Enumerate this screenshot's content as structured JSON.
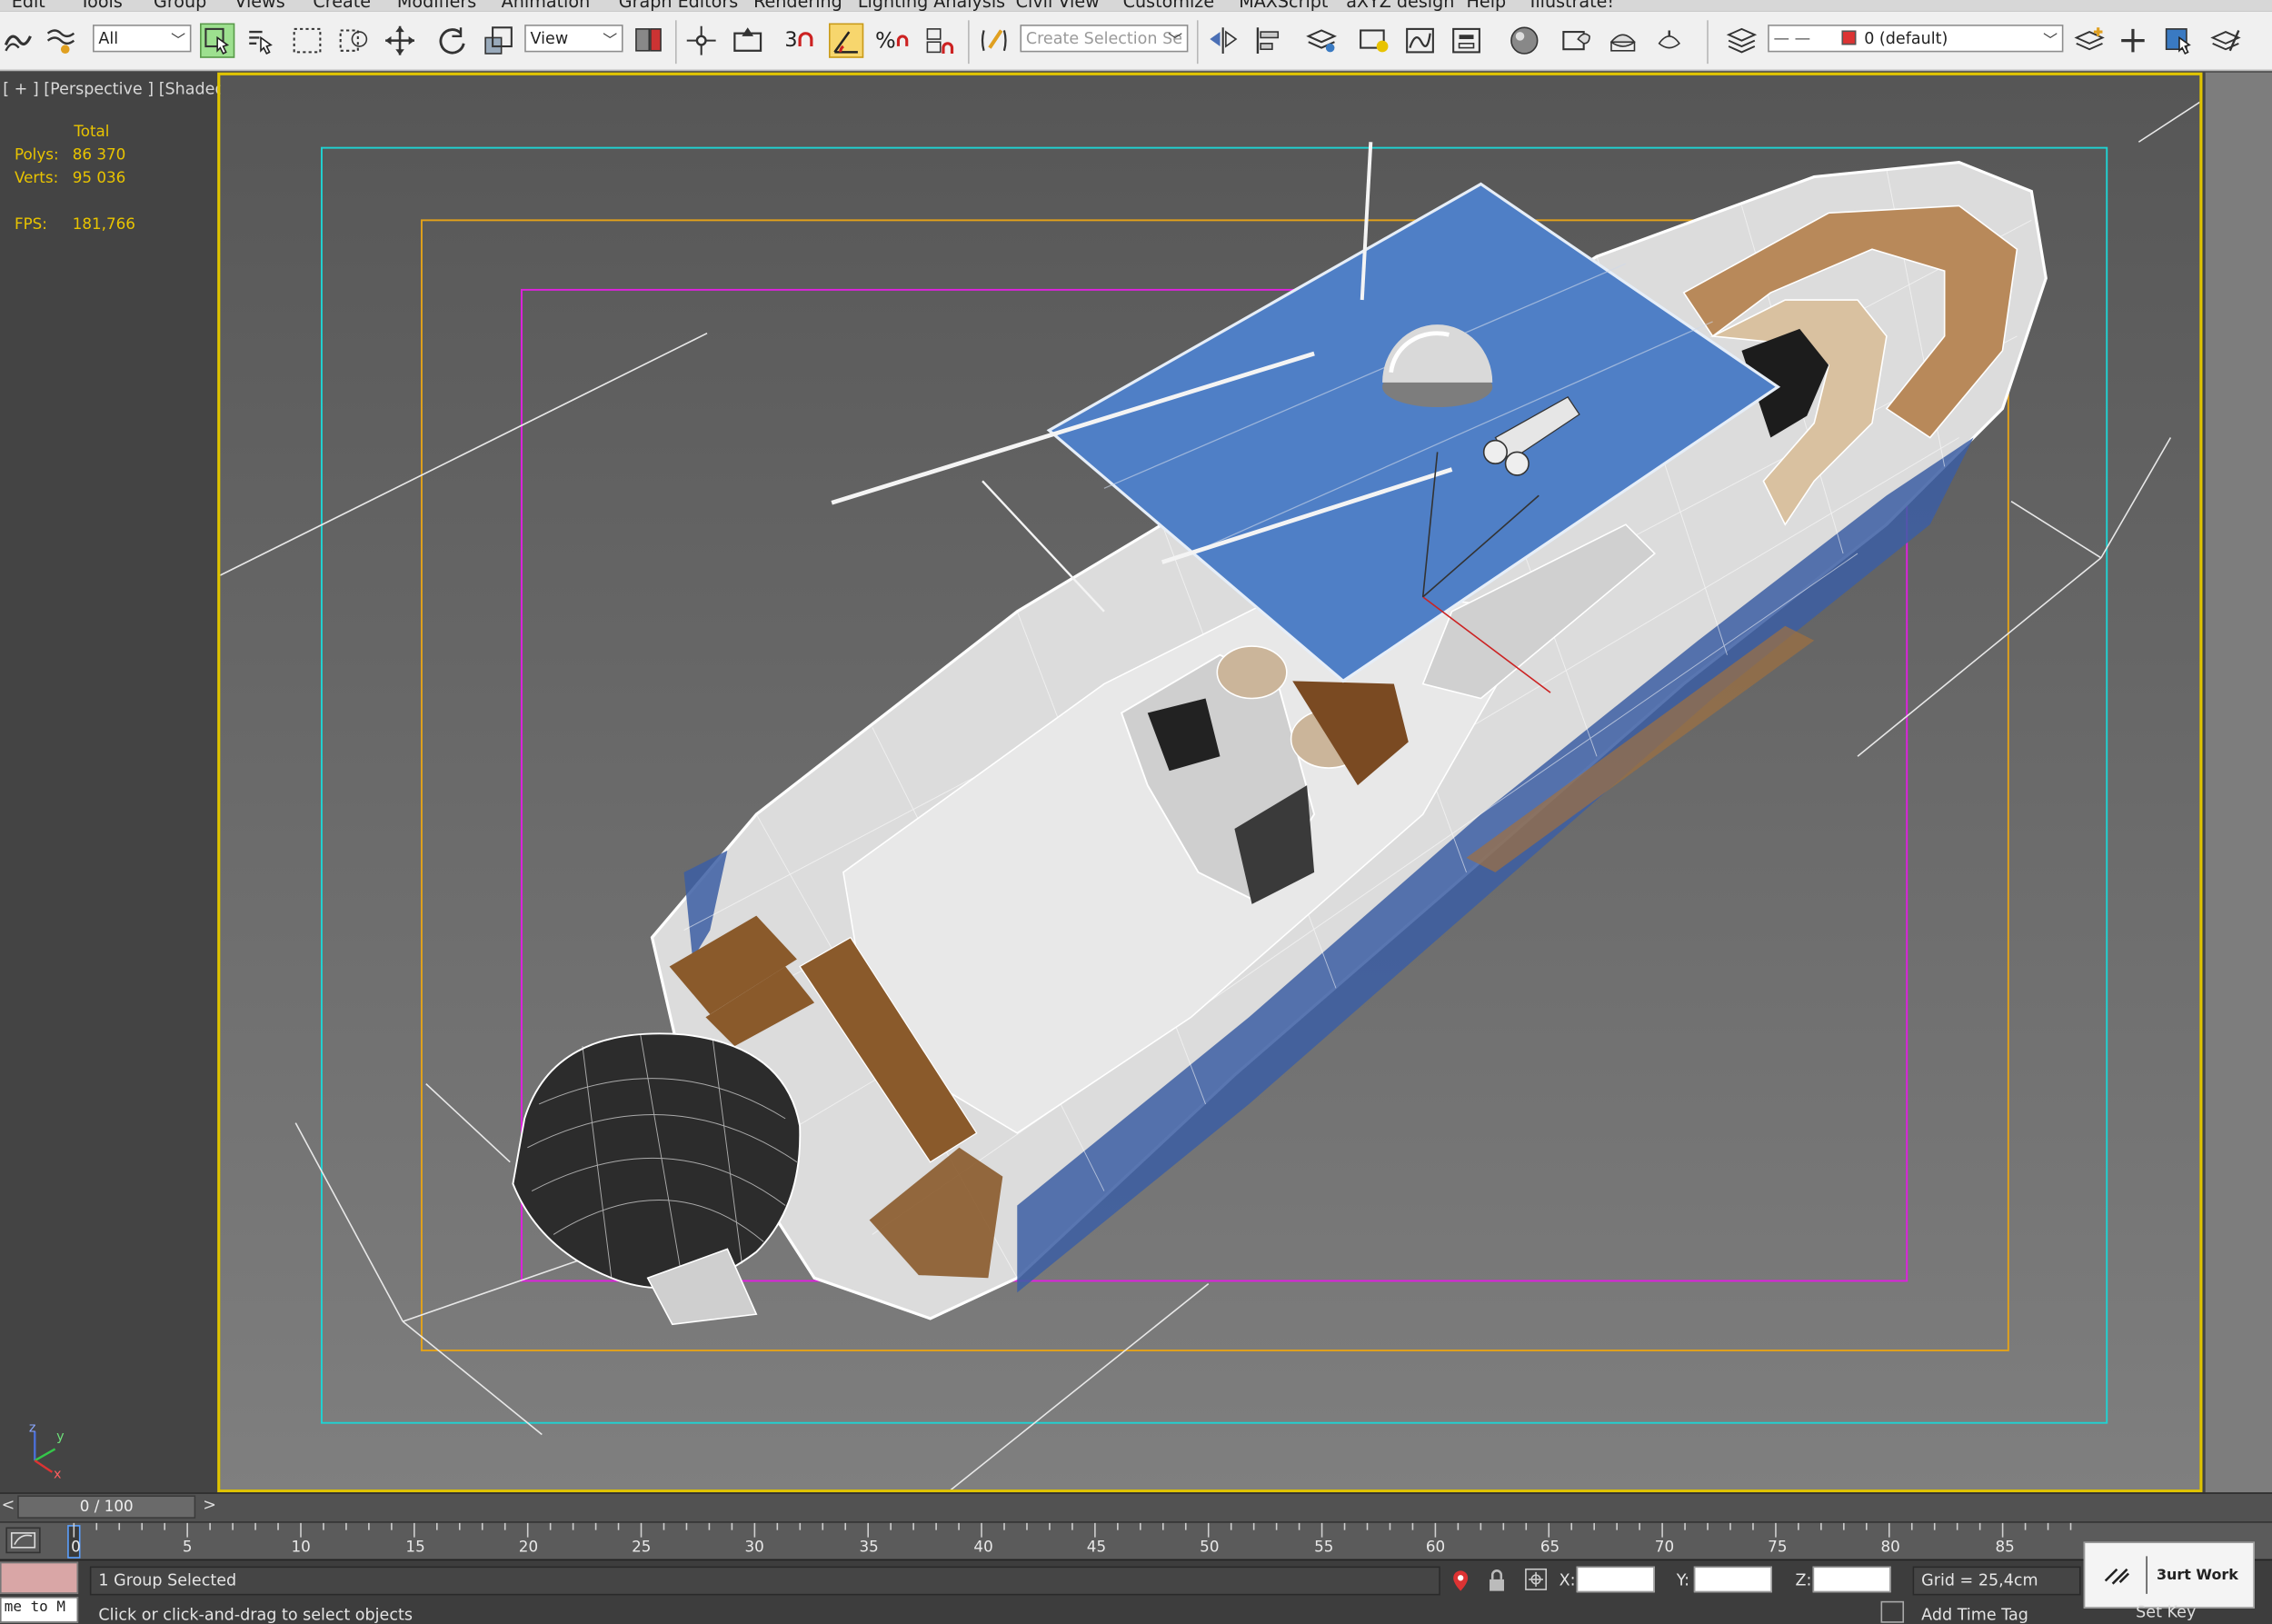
{
  "menu": [
    "Edit",
    "Tools",
    "Group",
    "Views",
    "Create",
    "Modifiers",
    "Animation",
    "Graph Editors",
    "Rendering",
    "Lighting Analysis",
    "Civil View",
    "Customize",
    "MAXScript",
    "aXYZ design",
    "Help",
    "Illustrate!"
  ],
  "toolbar": {
    "selection_filter": "All",
    "reference_coord": "View",
    "snap_number": "3",
    "named_selection_placeholder": "Create Selection Se",
    "layer": "0 (default)"
  },
  "viewport": {
    "label": "[ + ] [Perspective ] [Shaded + Edged Faces ]",
    "stats": {
      "header": "Total",
      "polys_label": "Polys:",
      "polys_value": "86 370",
      "verts_label": "Verts:",
      "verts_value": "95 036",
      "fps_label": "FPS:",
      "fps_value": "181,766"
    },
    "axis": {
      "z": "z",
      "y": "y",
      "x": "x"
    }
  },
  "timeline": {
    "frame_display": "0 / 100",
    "prev": "<",
    "next": ">",
    "ticks": [
      "0",
      "5",
      "10",
      "15",
      "20",
      "25",
      "30",
      "35",
      "40",
      "45",
      "50",
      "55",
      "60",
      "65",
      "70",
      "75",
      "80",
      "85"
    ]
  },
  "status": {
    "selection": "1 Group Selected",
    "prompt": "Click or click-and-drag to select objects",
    "maxscript": "me to M",
    "x_label": "X:",
    "y_label": "Y:",
    "z_label": "Z:",
    "grid": "Grid = 25,4cm",
    "add_time_tag": "Add Time Tag",
    "set_key": "Set Key",
    "watermark": "3urt Work"
  },
  "colors": {
    "viewport_border": "#e0c400",
    "safe_cyan": "#1fd3d3",
    "safe_orange": "#e3a21a",
    "safe_magenta": "#e020e0",
    "canopy_blue": "#4f7fc6",
    "teak": "#8a5a2b"
  }
}
